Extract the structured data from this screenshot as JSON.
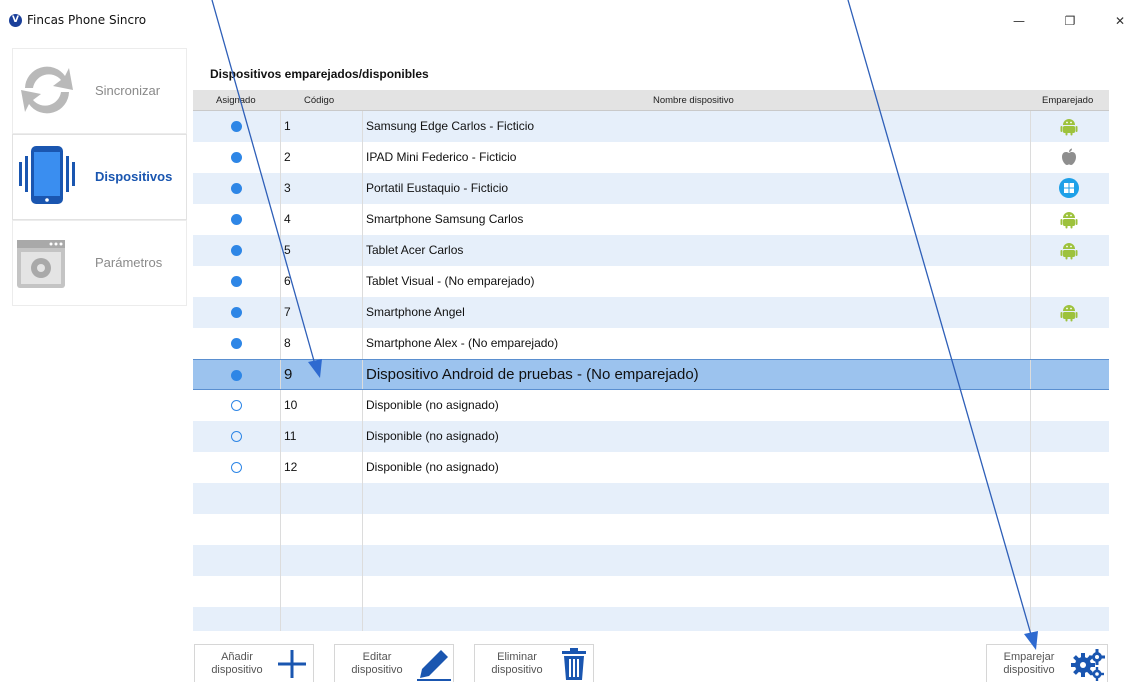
{
  "window": {
    "title": "Fincas Phone Sincro",
    "logo_letter": "V",
    "minimize": "—",
    "restore": "❐",
    "close": "✕"
  },
  "sidebar": {
    "items": [
      {
        "label": "Sincronizar",
        "icon": "sync-icon",
        "active": false
      },
      {
        "label": "Dispositivos",
        "icon": "mobile-device-icon",
        "active": true
      },
      {
        "label": "Parámetros",
        "icon": "settings-window-icon",
        "active": false
      }
    ]
  },
  "grid": {
    "title": "Dispositivos emparejados/disponibles",
    "columns": {
      "assigned": "Asignado",
      "code": "Código",
      "name": "Nombre dispositivo",
      "paired": "Emparejado"
    },
    "rows": [
      {
        "assigned": true,
        "code": "1",
        "name": "Samsung Edge Carlos - Ficticio",
        "os": "android"
      },
      {
        "assigned": true,
        "code": "2",
        "name": "IPAD Mini Federico - Ficticio",
        "os": "apple"
      },
      {
        "assigned": true,
        "code": "3",
        "name": "Portatil Eustaquio - Ficticio",
        "os": "windows"
      },
      {
        "assigned": true,
        "code": "4",
        "name": "Smartphone Samsung Carlos",
        "os": "android"
      },
      {
        "assigned": true,
        "code": "5",
        "name": "Tablet Acer Carlos",
        "os": "android"
      },
      {
        "assigned": true,
        "code": "6",
        "name": "Tablet Visual - (No emparejado)",
        "os": ""
      },
      {
        "assigned": true,
        "code": "7",
        "name": "Smartphone Angel",
        "os": "android"
      },
      {
        "assigned": true,
        "code": "8",
        "name": "Smartphone Alex - (No emparejado)",
        "os": ""
      },
      {
        "assigned": true,
        "code": "9",
        "name": "Dispositivo Android de pruebas - (No emparejado)",
        "os": "",
        "selected": true
      },
      {
        "assigned": false,
        "code": "10",
        "name": "Disponible (no asignado)",
        "os": ""
      },
      {
        "assigned": false,
        "code": "11",
        "name": "Disponible (no asignado)",
        "os": ""
      },
      {
        "assigned": false,
        "code": "12",
        "name": "Disponible (no asignado)",
        "os": ""
      }
    ],
    "empty_rows": 5
  },
  "buttons": {
    "add": {
      "line1": "Añadir",
      "line2": "dispositivo",
      "icon": "plus-icon"
    },
    "edit": {
      "line1": "Editar",
      "line2": "dispositivo",
      "icon": "pencil-icon"
    },
    "delete": {
      "line1": "Eliminar",
      "line2": "dispositivo",
      "icon": "trash-icon"
    },
    "pair": {
      "line1": "Emparejar",
      "line2": "dispositivo",
      "icon": "gears-icon"
    }
  },
  "colors": {
    "accent": "#1a56b0",
    "dot": "#2e86e6",
    "selected_row": "#9cc3ee",
    "alt_row": "#e6effa",
    "android": "#9dc23c",
    "windows": "#1ea0e8"
  }
}
